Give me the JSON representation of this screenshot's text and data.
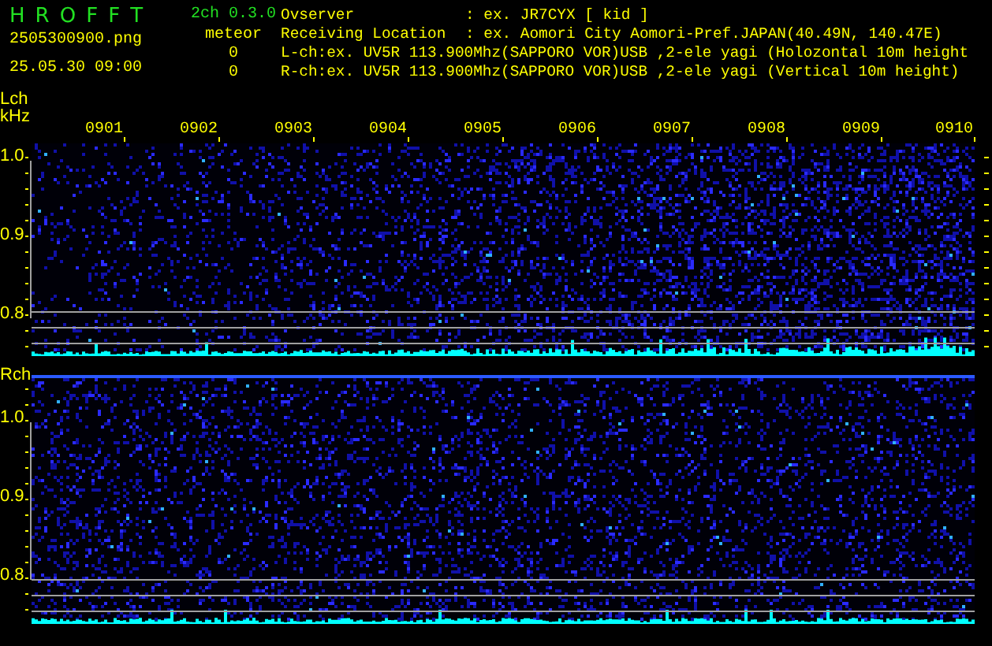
{
  "header": {
    "app_name": "H R O F F T",
    "version": "2ch 0.3.0",
    "file_name": "2505300900.png",
    "timestamp": "25.05.30 09:00",
    "meteor_label": "meteor",
    "meteor_counts": [
      "0",
      "0"
    ],
    "info": [
      {
        "kind": "field",
        "label": "Ovserver",
        "value": ": ex. JR7CYX [ kid ]"
      },
      {
        "kind": "field",
        "label": "Receiving Location",
        "value": ": ex. Aomori City Aomori-Pref.JAPAN(40.49N, 140.47E)"
      },
      {
        "kind": "line",
        "text": "L-ch:ex. UV5R 113.900Mhz(SAPPORO VOR)USB ,2-ele yagi (Holozontal 10m height"
      },
      {
        "kind": "line",
        "text": "R-ch:ex. UV5R 113.900Mhz(SAPPORO VOR)USB ,2-ele yagi (Vertical 10m height)"
      }
    ]
  },
  "panels": [
    {
      "channel_label": "Lch",
      "unit_label": "kHz",
      "time_labels": [
        "0901",
        "0902",
        "0903",
        "0904",
        "0905",
        "0906",
        "0907",
        "0908",
        "0909",
        "0910"
      ],
      "freq_labels": [
        "1.0",
        "0.9",
        "0.8"
      ]
    },
    {
      "channel_label": "Rch",
      "freq_labels": [
        "1.0",
        "0.9",
        "0.8"
      ]
    }
  ]
}
